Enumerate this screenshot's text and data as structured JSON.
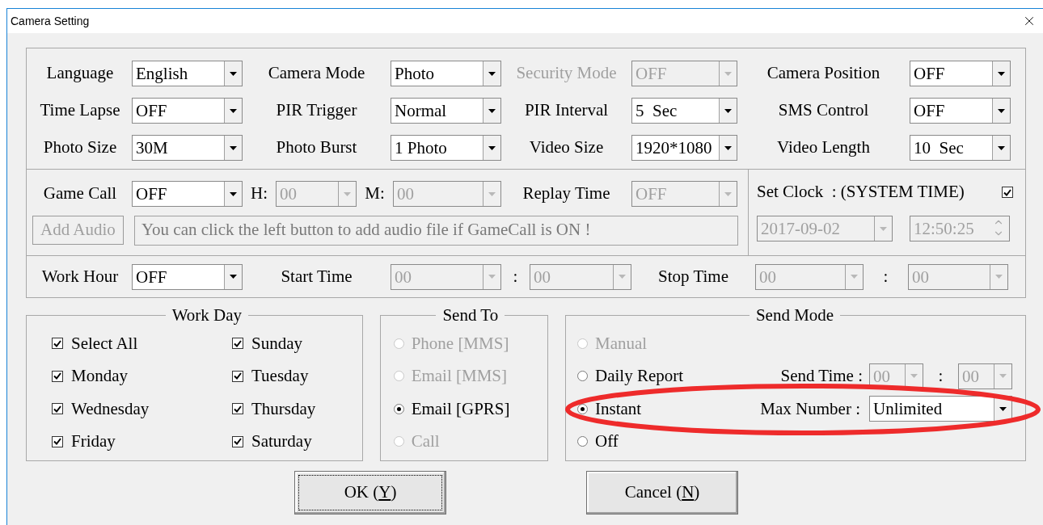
{
  "window": {
    "title": "Camera Setting"
  },
  "settings": [
    {
      "label": "Language",
      "value": "English",
      "disabled": false
    },
    {
      "label": "Camera Mode",
      "value": "Photo",
      "disabled": false
    },
    {
      "label": "Security Mode",
      "value": "OFF",
      "disabled": true
    },
    {
      "label": "Camera Position",
      "value": "OFF",
      "disabled": false
    },
    {
      "label": "Time Lapse",
      "value": "OFF",
      "disabled": false
    },
    {
      "label": "PIR Trigger",
      "value": "Normal",
      "disabled": false
    },
    {
      "label": "PIR Interval",
      "value": "5  Sec",
      "disabled": false
    },
    {
      "label": "SMS Control",
      "value": "OFF",
      "disabled": false
    },
    {
      "label": "Photo Size",
      "value": "30M",
      "disabled": false
    },
    {
      "label": "Photo Burst",
      "value": "1 Photo",
      "disabled": false
    },
    {
      "label": "Video Size",
      "value": "1920*1080",
      "disabled": false
    },
    {
      "label": "Video Length",
      "value": "10  Sec",
      "disabled": false
    }
  ],
  "game_call": {
    "label": "Game Call",
    "value": "OFF",
    "disabled": false
  },
  "hour": {
    "label": "H:",
    "value": "00",
    "disabled": true
  },
  "minute": {
    "label": "M:",
    "value": "00",
    "disabled": true
  },
  "replay_time": {
    "label": "Replay Time",
    "value": "OFF",
    "disabled": true
  },
  "add_audio": {
    "label": "Add Audio",
    "disabled": true
  },
  "audio_hint": {
    "value": "You can click the left button to add audio file if GameCall is ON !",
    "disabled": true
  },
  "set_clock": {
    "label": "Set Clock  : (SYSTEM TIME)",
    "checked": true,
    "date": "2017-09-02",
    "time": "12:50:25",
    "disabled": true
  },
  "work_hour": {
    "label": "Work Hour",
    "value": "OFF",
    "disabled": false
  },
  "start_time": {
    "label": "Start Time",
    "hour": "00",
    "separator": ":",
    "minute": "00",
    "disabled": true
  },
  "stop_time": {
    "label": "Stop Time",
    "hour": "00",
    "separator": ":",
    "minute": "00",
    "disabled": true
  },
  "work_day": {
    "title": "Work Day",
    "days": [
      {
        "label": "Select All",
        "checked": true
      },
      {
        "label": "Sunday",
        "checked": true
      },
      {
        "label": "Monday",
        "checked": true
      },
      {
        "label": "Tuesday",
        "checked": true
      },
      {
        "label": "Wednesday",
        "checked": true
      },
      {
        "label": "Thursday",
        "checked": true
      },
      {
        "label": "Friday",
        "checked": true
      },
      {
        "label": "Saturday",
        "checked": true
      }
    ]
  },
  "send_to": {
    "title": "Send To",
    "options": [
      {
        "label": "Phone [MMS]",
        "selected": false,
        "disabled": true
      },
      {
        "label": "Email [MMS]",
        "selected": false,
        "disabled": true
      },
      {
        "label": "Email [GPRS]",
        "selected": true,
        "disabled": false
      },
      {
        "label": "Call",
        "selected": false,
        "disabled": true
      }
    ]
  },
  "send_mode": {
    "title": "Send Mode",
    "options": [
      {
        "label": "Manual",
        "selected": false,
        "disabled": true
      },
      {
        "label": "Daily Report",
        "selected": false,
        "disabled": false
      },
      {
        "label": "Instant",
        "selected": true,
        "disabled": false
      },
      {
        "label": "Off",
        "selected": false,
        "disabled": false
      }
    ],
    "send_time": {
      "label": "Send Time :",
      "hour": "00",
      "separator": ":",
      "minute": "00",
      "disabled": true
    },
    "max_number": {
      "label": "Max Number :",
      "value": "Unlimited",
      "disabled": false
    }
  },
  "buttons": [
    {
      "before": "OK (",
      "mnemonic": "Y",
      "after": ")",
      "focused": true
    },
    {
      "before": "Cancel (",
      "mnemonic": "N",
      "after": ")",
      "focused": false
    }
  ],
  "annotation": {
    "kind": "ellipse"
  }
}
